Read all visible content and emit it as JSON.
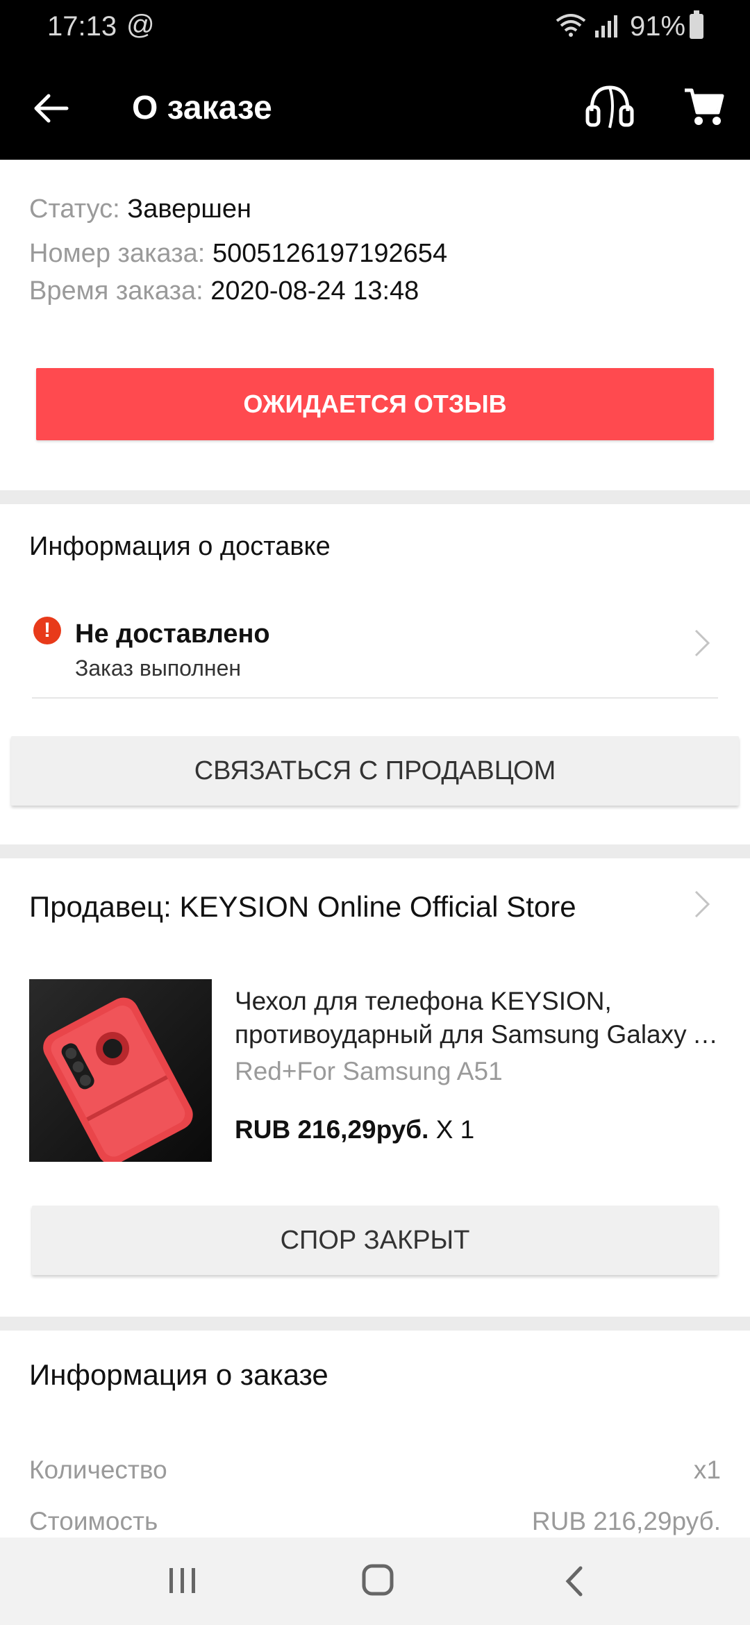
{
  "status_bar": {
    "time": "17:13",
    "at_symbol": "@",
    "battery": "91%",
    "icons": [
      "wifi-icon",
      "signal-icon",
      "battery-icon"
    ]
  },
  "app_bar": {
    "title": "О заказе",
    "icons": [
      "back-arrow-icon",
      "headset-support-icon",
      "cart-icon"
    ]
  },
  "order": {
    "status_label": "Статус:",
    "status_value": "Завершен",
    "number_label": "Номер заказа:",
    "number_value": "5005126197192654",
    "time_label": "Время заказа:",
    "time_value": "2020-08-24 13:48",
    "review_button": "ОЖИДАЕТСЯ ОТЗЫВ"
  },
  "delivery": {
    "title": "Информация о доставке",
    "status_title": "Не доставлено",
    "status_sub": "Заказ выполнен",
    "contact_button": "СВЯЗАТЬСЯ С ПРОДАВЦОМ"
  },
  "seller": {
    "label": "Продавец: KEYSION Online Official Store",
    "product": {
      "name_line1": "Чехол для телефона KEYSION,",
      "name_line2": "противоударный для Samsung Galaxy A51",
      "variant": "Red+For Samsung A51",
      "price": "RUB 216,29руб.",
      "quantity": "X 1"
    },
    "dispute_button": "СПОР ЗАКРЫТ"
  },
  "order_info": {
    "title": "Информация о заказе",
    "rows": [
      {
        "label": "Количество",
        "value": "x1"
      },
      {
        "label": "Стоимость",
        "value": "RUB 216,29руб."
      }
    ]
  },
  "colors": {
    "accent_red": "#ff4a4f",
    "alert_red": "#e83a1a",
    "bar_black": "#000000"
  }
}
